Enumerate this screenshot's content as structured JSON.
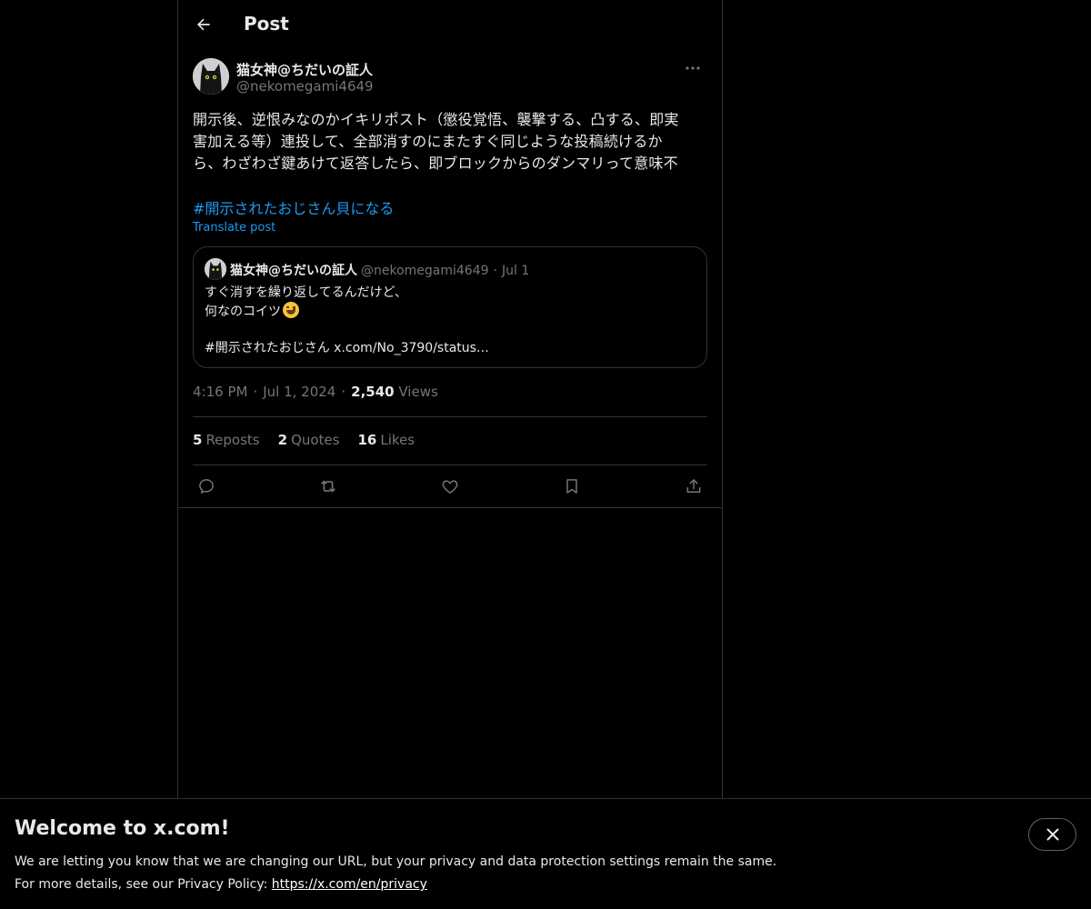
{
  "header": {
    "title": "Post",
    "back_icon": "arrow-left-icon"
  },
  "post": {
    "author_name": "猫女神@ちだいの証人",
    "author_handle": "@nekomegami4649",
    "more_icon": "more-horizontal-icon",
    "text_lines": [
      "開示後、逆恨みなのかイキリポスト（懲役覚悟、襲撃する、凸する、即実",
      "害加える等）連投して、全部消すのにまたすぐ同じような投稿続けるか",
      "ら、わざわざ鍵あけて返答したら、即ブロックからのダンマリって意味不"
    ],
    "hashtag": "#開示されたおじさん貝になる",
    "translate_label": "Translate post",
    "time": "4:16 PM",
    "date": "Jul 1, 2024",
    "views_count": "2,540",
    "views_label": "Views"
  },
  "quote": {
    "author_name": "猫女神@ちだいの証人",
    "author_handle": "@nekomegami4649",
    "separator": "·",
    "date": "Jul 1",
    "line1": "すぐ消すを繰り返してるんだけど、",
    "line2": "何なのコイツ",
    "line2_emoji": "grinning-sweat-emoji",
    "line3": "",
    "line4": "#開示されたおじさん x.com/No_3790/status…"
  },
  "stats": {
    "reposts_count": "5",
    "reposts_label": "Reposts",
    "quotes_count": "2",
    "quotes_label": "Quotes",
    "likes_count": "16",
    "likes_label": "Likes"
  },
  "actions": [
    "reply-icon",
    "repost-icon",
    "like-icon",
    "bookmark-icon",
    "share-icon"
  ],
  "banner": {
    "title": "Welcome to x.com!",
    "line1": "We are letting you know that we are changing our URL, but your privacy and data protection settings remain the same.",
    "line2_prefix": "For more details, see our Privacy Policy: ",
    "link": "https://x.com/en/privacy",
    "close_icon": "close-icon"
  },
  "colors": {
    "background": "#000000",
    "text": "#e7e9ea",
    "secondary": "#71767b",
    "accent": "#1d9bf0",
    "border": "#2f3336"
  }
}
